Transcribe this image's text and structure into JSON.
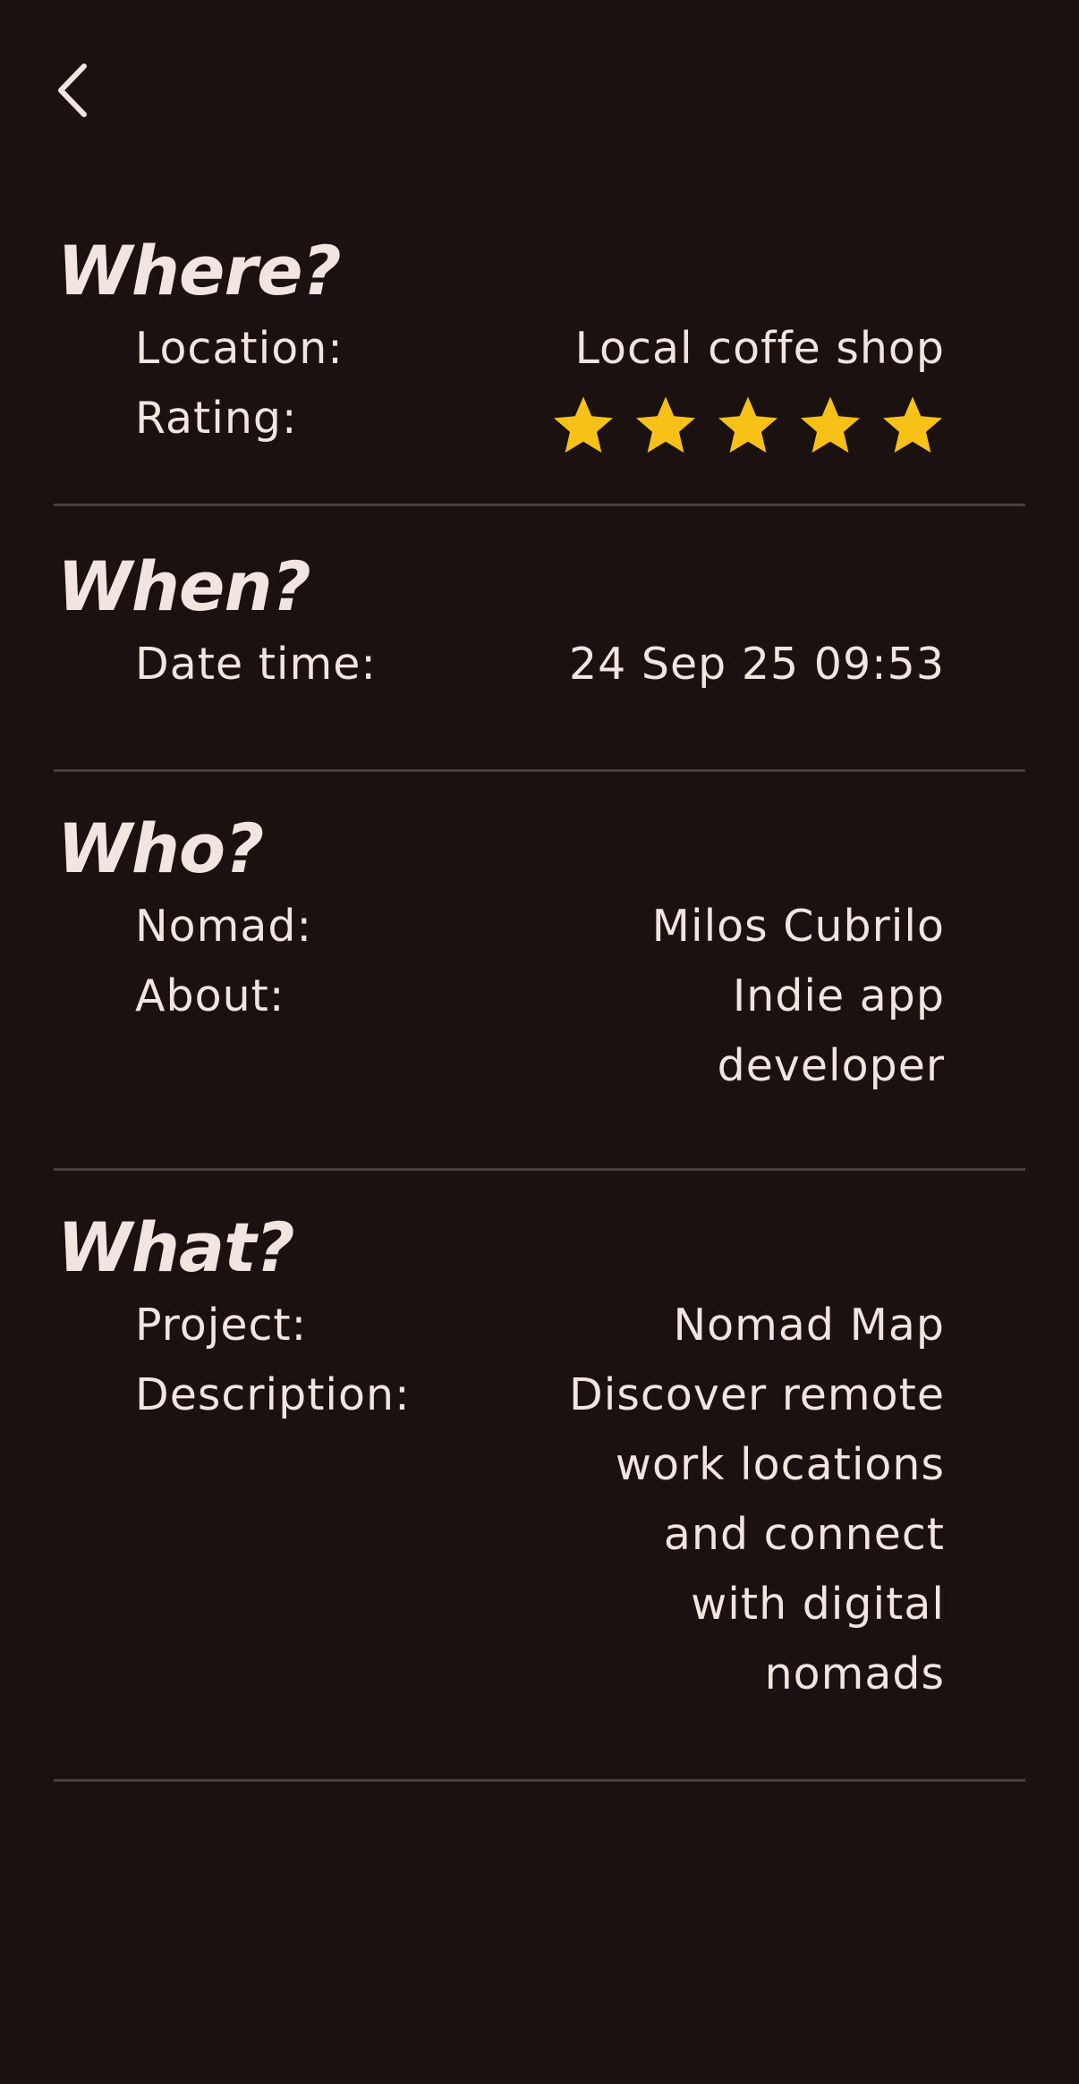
{
  "back_icon": "chevron-left-icon",
  "colors": {
    "background": "#1a1110",
    "text": "#f2e4df",
    "divider": "#4a3f3d",
    "star": "#f8c117"
  },
  "where": {
    "heading": "Where?",
    "location_label": "Location:",
    "location_value": "Local coffe shop",
    "rating_label": "Rating:",
    "rating_value": 5,
    "rating_max": 5
  },
  "when": {
    "heading": "When?",
    "datetime_label": "Date time:",
    "datetime_value": "24 Sep 25 09:53"
  },
  "who": {
    "heading": "Who?",
    "nomad_label": "Nomad:",
    "nomad_value": "Milos Cubrilo",
    "about_label": "About:",
    "about_value": "Indie app\ndeveloper"
  },
  "what": {
    "heading": "What?",
    "project_label": "Project:",
    "project_value": "Nomad Map",
    "description_label": "Description:",
    "description_value": "Discover remote\nwork locations\nand connect\nwith digital\nnomads"
  }
}
